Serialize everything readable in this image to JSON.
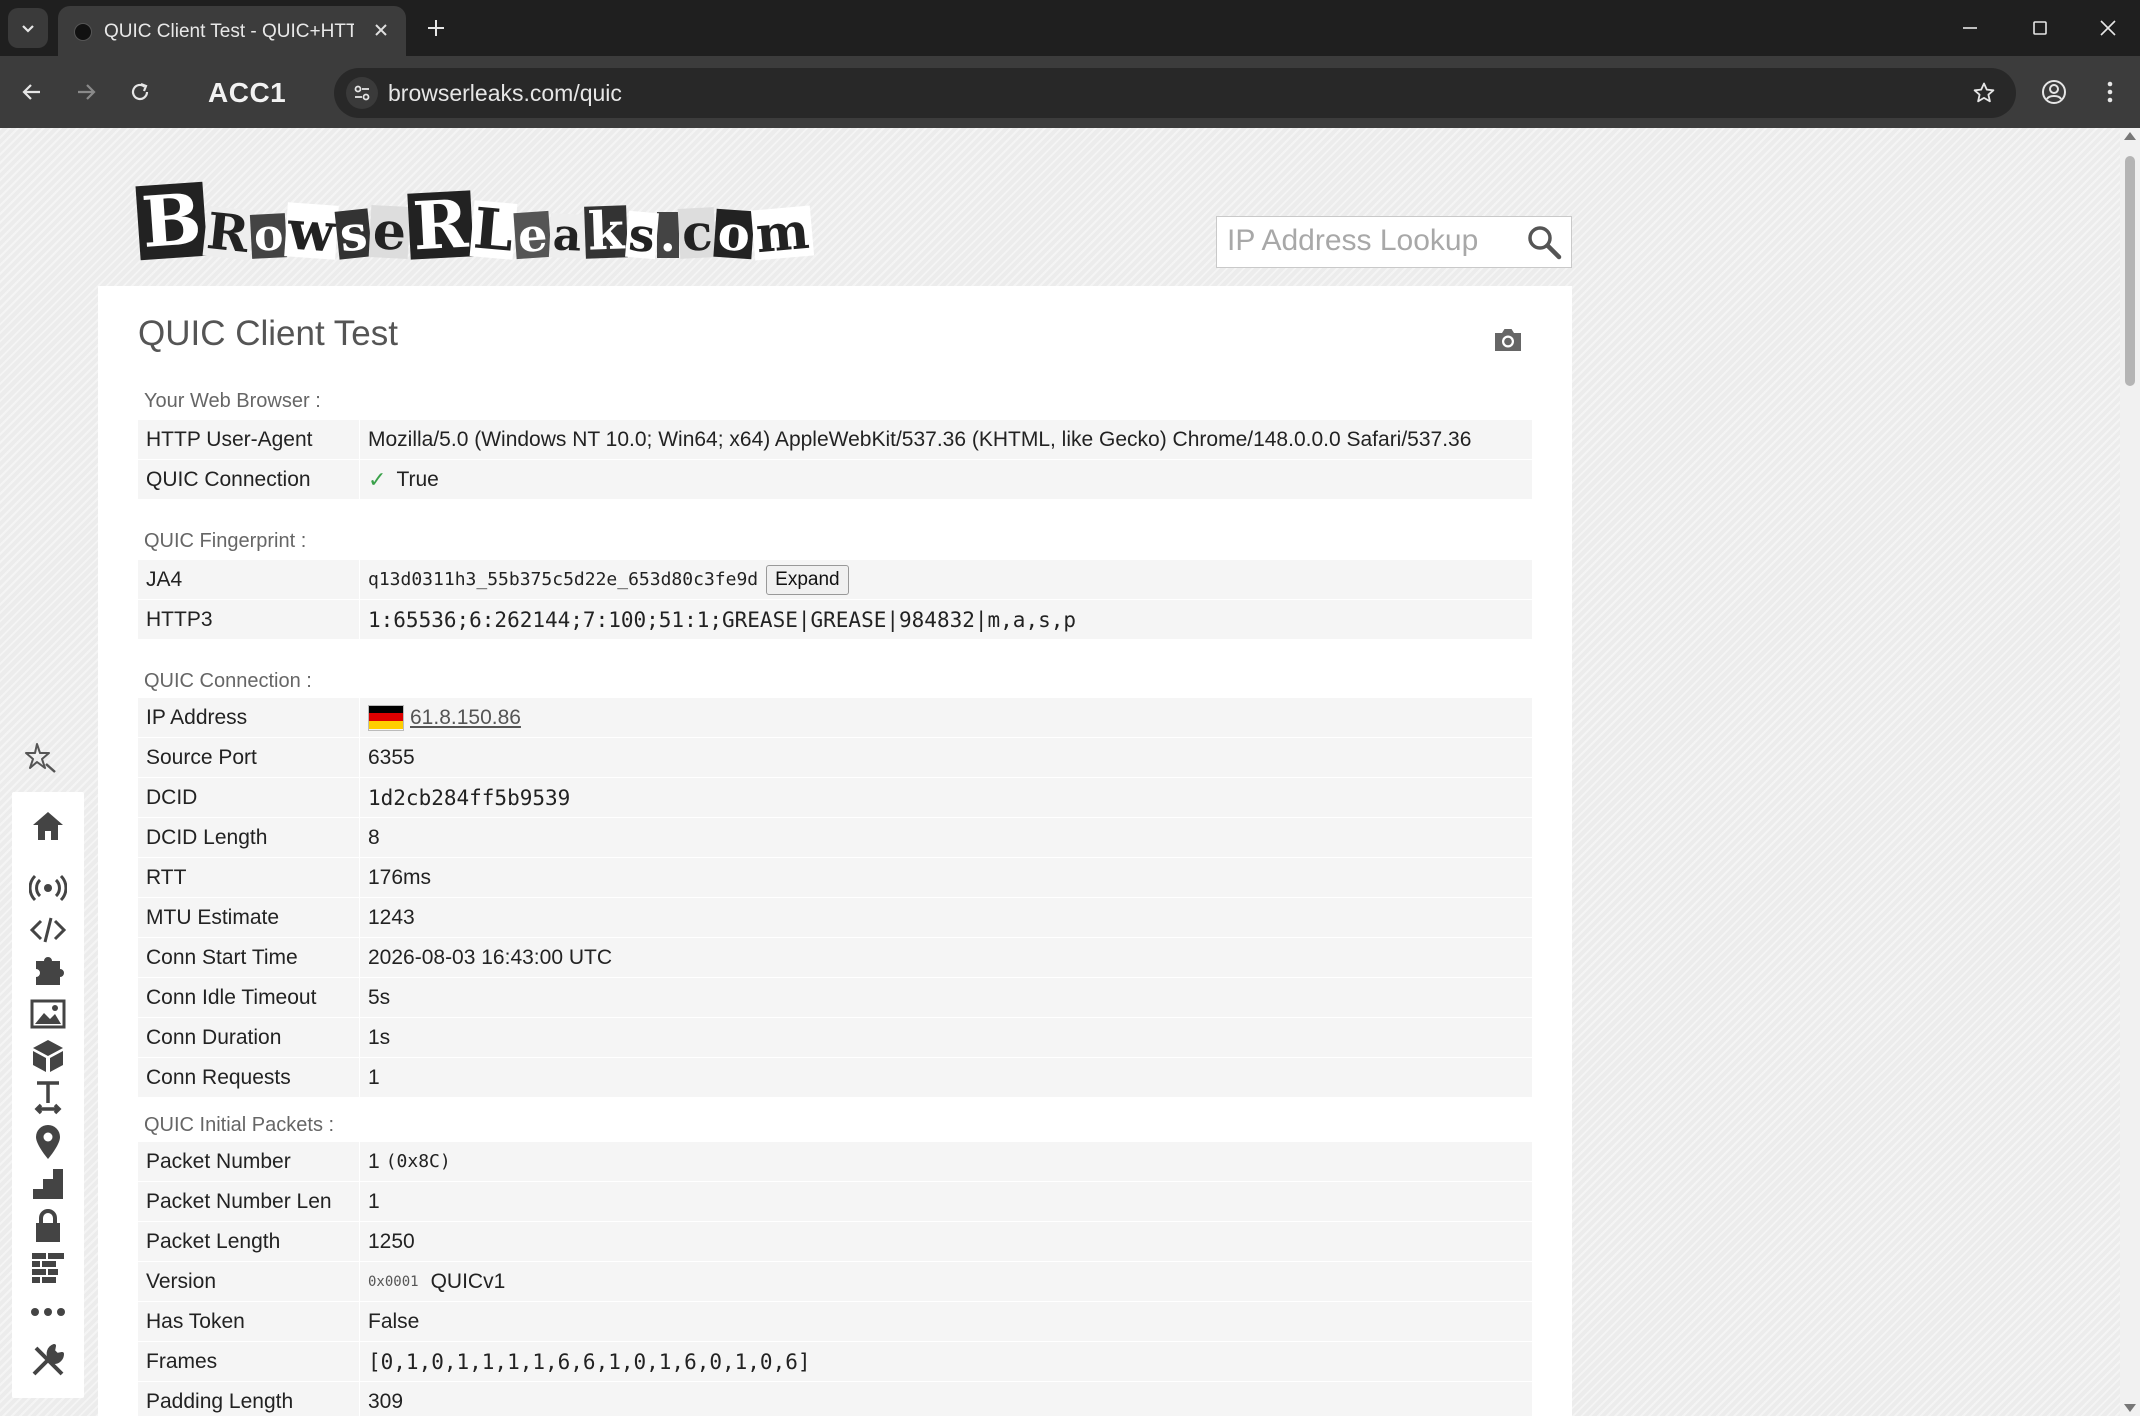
{
  "browser": {
    "tab_title": "QUIC Client Test - QUIC+HTTP/",
    "profile_label": "ACC1",
    "url": "browserleaks.com/quic"
  },
  "page": {
    "logo_text": "BrowserLeaks.com",
    "search_placeholder": "IP Address Lookup",
    "title": "QUIC Client Test",
    "sections": {
      "browser": {
        "title": "Your Web Browser :",
        "rows": [
          {
            "key": "HTTP User-Agent",
            "value": "Mozilla/5.0 (Windows NT 10.0; Win64; x64) AppleWebKit/537.36 (KHTML, like Gecko) Chrome/148.0.0.0 Safari/537.36"
          },
          {
            "key": "QUIC Connection",
            "value": "True"
          }
        ]
      },
      "fingerprint": {
        "title": "QUIC Fingerprint :",
        "rows": [
          {
            "key": "JA4",
            "value": "q13d0311h3_55b375c5d22e_653d80c3fe9d"
          },
          {
            "key": "HTTP3",
            "value": "1:65536;6:262144;7:100;51:1;GREASE|GREASE|984832|m,a,s,p"
          }
        ],
        "expand_label": "Expand"
      },
      "connection": {
        "title": "QUIC Connection :",
        "ip": {
          "key": "IP Address",
          "value": "61.8.150.86"
        },
        "rows": [
          {
            "key": "Source Port",
            "value": "6355"
          },
          {
            "key": "DCID",
            "value": "1d2cb284ff5b9539"
          },
          {
            "key": "DCID Length",
            "value": "8"
          },
          {
            "key": "RTT",
            "value": "176ms"
          },
          {
            "key": "MTU Estimate",
            "value": "1243"
          },
          {
            "key": "Conn Start Time",
            "value": "2026-08-03 16:43:00 UTC"
          },
          {
            "key": "Conn Idle Timeout",
            "value": "5s"
          },
          {
            "key": "Conn Duration",
            "value": "1s"
          },
          {
            "key": "Conn Requests",
            "value": "1"
          }
        ]
      },
      "packets": {
        "title": "QUIC Initial Packets :",
        "rows": [
          {
            "key": "Packet Number",
            "value": "1",
            "extra": "(0x8C)"
          },
          {
            "key": "Packet Number Len",
            "value": "1"
          },
          {
            "key": "Packet Length",
            "value": "1250"
          },
          {
            "key": "Version",
            "hex": "0x0001",
            "value": "QUICv1"
          },
          {
            "key": "Has Token",
            "value": "False"
          },
          {
            "key": "Frames",
            "value": "[0,1,0,1,1,1,1,6,6,1,0,1,6,0,1,0,6]"
          },
          {
            "key": "Padding Length",
            "value": "309"
          }
        ]
      }
    }
  },
  "sidebar": {
    "icons": [
      "home-icon",
      "broadcast-icon",
      "code-icon",
      "puzzle-icon",
      "image-icon",
      "cube-icon",
      "text-height-icon",
      "location-pin-icon",
      "chart-steps-icon",
      "lock-icon",
      "firewall-icon",
      "more-icon",
      "tools-icon"
    ]
  },
  "colors": {
    "accent_check": "#3aa14a",
    "chrome_dark": "#1f1f1f",
    "chrome_toolbar": "#3c3c3c"
  }
}
